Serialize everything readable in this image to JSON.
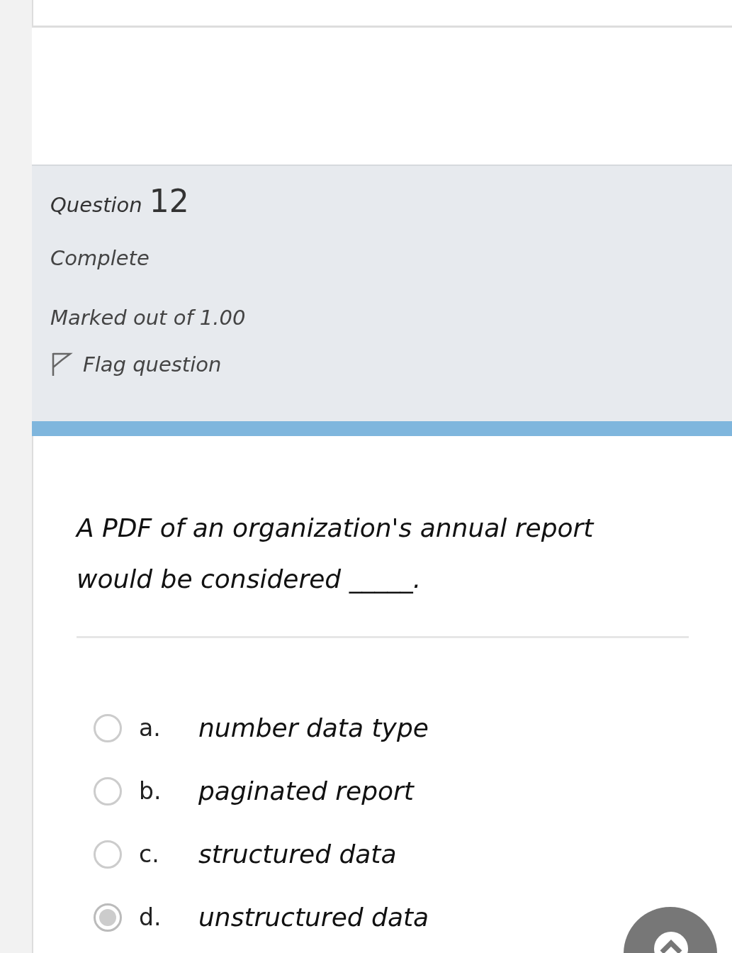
{
  "question": {
    "label": "Question",
    "number": "12",
    "state": "Complete",
    "marks": "Marked out of 1.00",
    "flag": {
      "label": "Flag question",
      "flagged": false
    }
  },
  "text": "A PDF of an organization's annual report would be considered _____.",
  "options": [
    {
      "letter": "a.",
      "text": "number data type",
      "selected": false
    },
    {
      "letter": "b.",
      "text": "paginated report",
      "selected": false
    },
    {
      "letter": "c.",
      "text": "structured data",
      "selected": false
    },
    {
      "letter": "d.",
      "text": "unstructured data",
      "selected": true
    }
  ]
}
